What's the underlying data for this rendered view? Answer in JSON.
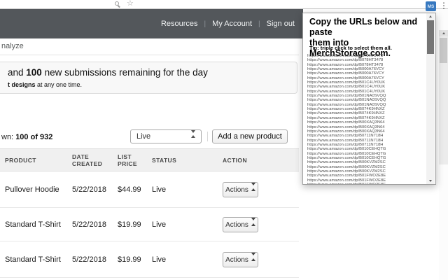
{
  "browser": {
    "extension_badge": "MS",
    "menu_icon": "⋮",
    "bookmark_star": "☆"
  },
  "header": {
    "links": [
      "Resources",
      "My Account",
      "Sign out"
    ],
    "separator": "|"
  },
  "subnav": {
    "visible_item_fragment": "nalyze"
  },
  "notice": {
    "line1_start": "and ",
    "line1_bold": "100",
    "line1_rest": " new submissions remaining for the day",
    "line2_bold": "t designs",
    "line2_rest": " at any one time."
  },
  "controls": {
    "shown_fragment": "wn: ",
    "shown_count": "100 of 932",
    "filter_selected": "Live",
    "add_product_label": "Add a new product"
  },
  "table": {
    "columns": [
      "PRODUCT",
      "DATE CREATED",
      "LIST PRICE",
      "STATUS",
      "ACTION"
    ],
    "actions_label": "Actions",
    "rows": [
      {
        "product": "Pullover Hoodie",
        "date_created": "5/22/2018",
        "list_price": "$44.99",
        "status": "Live"
      },
      {
        "product": "Standard T-Shirt",
        "date_created": "5/22/2018",
        "list_price": "$19.99",
        "status": "Live"
      },
      {
        "product": "Standard T-Shirt",
        "date_created": "5/22/2018",
        "list_price": "$19.99",
        "status": "Live"
      }
    ]
  },
  "popup": {
    "title": "Copy the URLs below and paste\nthem into MerchStorage.com.",
    "tip": "Tip: triple click to select them all.",
    "urls": [
      "https://www.amazon.com/dp/B078HT3478",
      "https://www.amazon.com/dp/B078HT3478",
      "https://www.amazon.com/dp/B078HT3478",
      "https://www.amazon.com/dp/B000A76VCY",
      "https://www.amazon.com/dp/B000A76VCY",
      "https://www.amazon.com/dp/B000A76VCY",
      "https://www.amazon.com/dp/B01C4UY0UK",
      "https://www.amazon.com/dp/B01C4UY0UK",
      "https://www.amazon.com/dp/B01C4UY0UK",
      "https://www.amazon.com/dp/B01NA0SVQQ",
      "https://www.amazon.com/dp/B01NA0SVQQ",
      "https://www.amazon.com/dp/B01NA0SVQQ",
      "https://www.amazon.com/dp/B074K9HNXZ",
      "https://www.amazon.com/dp/B074K9HNXZ",
      "https://www.amazon.com/dp/B074K9HNXZ",
      "https://www.amazon.com/dp/B00XAQ3N64",
      "https://www.amazon.com/dp/B00XAQ3N64",
      "https://www.amazon.com/dp/B00XAQ3N64",
      "https://www.amazon.com/dp/B0711N718H",
      "https://www.amazon.com/dp/B0711N718H",
      "https://www.amazon.com/dp/B0711N718H",
      "https://www.amazon.com/dp/B010CEHQTG",
      "https://www.amazon.com/dp/B010CEHQTG",
      "https://www.amazon.com/dp/B010CEHQTG",
      "https://www.amazon.com/dp/B00KVZM2SC",
      "https://www.amazon.com/dp/B00KVZM2SC",
      "https://www.amazon.com/dp/B00KVZM2SC",
      "https://www.amazon.com/dp/B01FWO2E8E",
      "https://www.amazon.com/dp/B01FWO2E8E",
      "https://www.amazon.com/dp/B01FWO2E8E"
    ]
  },
  "colors": {
    "header_bg": "#53575b",
    "extension_blue": "#3879c0",
    "table_header_bg": "#f0f0f0"
  }
}
